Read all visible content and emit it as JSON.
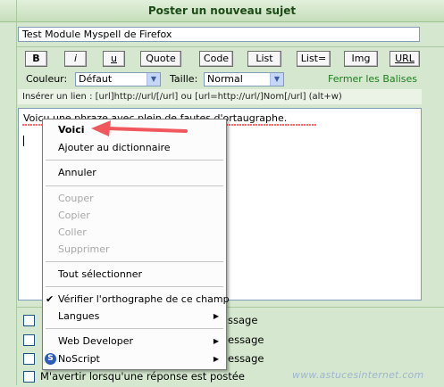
{
  "header": {
    "title": "Poster un nouveau sujet"
  },
  "subject": {
    "value": "Test Module Myspell de Firefox"
  },
  "toolbar": {
    "buttons": [
      {
        "label": "B"
      },
      {
        "label": "i"
      },
      {
        "label": "u"
      },
      {
        "label": "Quote"
      },
      {
        "label": "Code"
      },
      {
        "label": "List"
      },
      {
        "label": "List="
      },
      {
        "label": "Img"
      },
      {
        "label": "URL"
      }
    ],
    "color_label": "Couleur:",
    "color_value": "Défaut",
    "size_label": "Taille:",
    "size_value": "Normal",
    "close_tags": "Fermer les Balises"
  },
  "hint": "Insérer un lien : [url]http://url/[/url] ou [url=http://url/]Nom[/url] (alt+w)",
  "editor": {
    "text": "Voicu une phraze avec plein de fautes d'ortaugraphe."
  },
  "options": [
    {
      "text": "ssage"
    },
    {
      "text": "essage"
    },
    {
      "text": "essage"
    },
    {
      "text": "M'avertir lorsqu'une réponse est postée"
    }
  ],
  "context_menu": {
    "suggestion": "Voici",
    "add_dict": "Ajouter au dictionnaire",
    "undo": "Annuler",
    "cut": "Couper",
    "copy": "Copier",
    "paste": "Coller",
    "delete": "Supprimer",
    "select_all": "Tout sélectionner",
    "check_spelling": "Vérifier l'orthographe de ce champ",
    "languages": "Langues",
    "web_developer": "Web Developer",
    "noscript": "NoScript"
  },
  "watermark": "www.astucesinternet.com",
  "colors": {
    "header_text": "#1b4a17",
    "close_tags": "#1d7d1d",
    "arrow": "#f0585d",
    "background": "#d5e8cf"
  }
}
